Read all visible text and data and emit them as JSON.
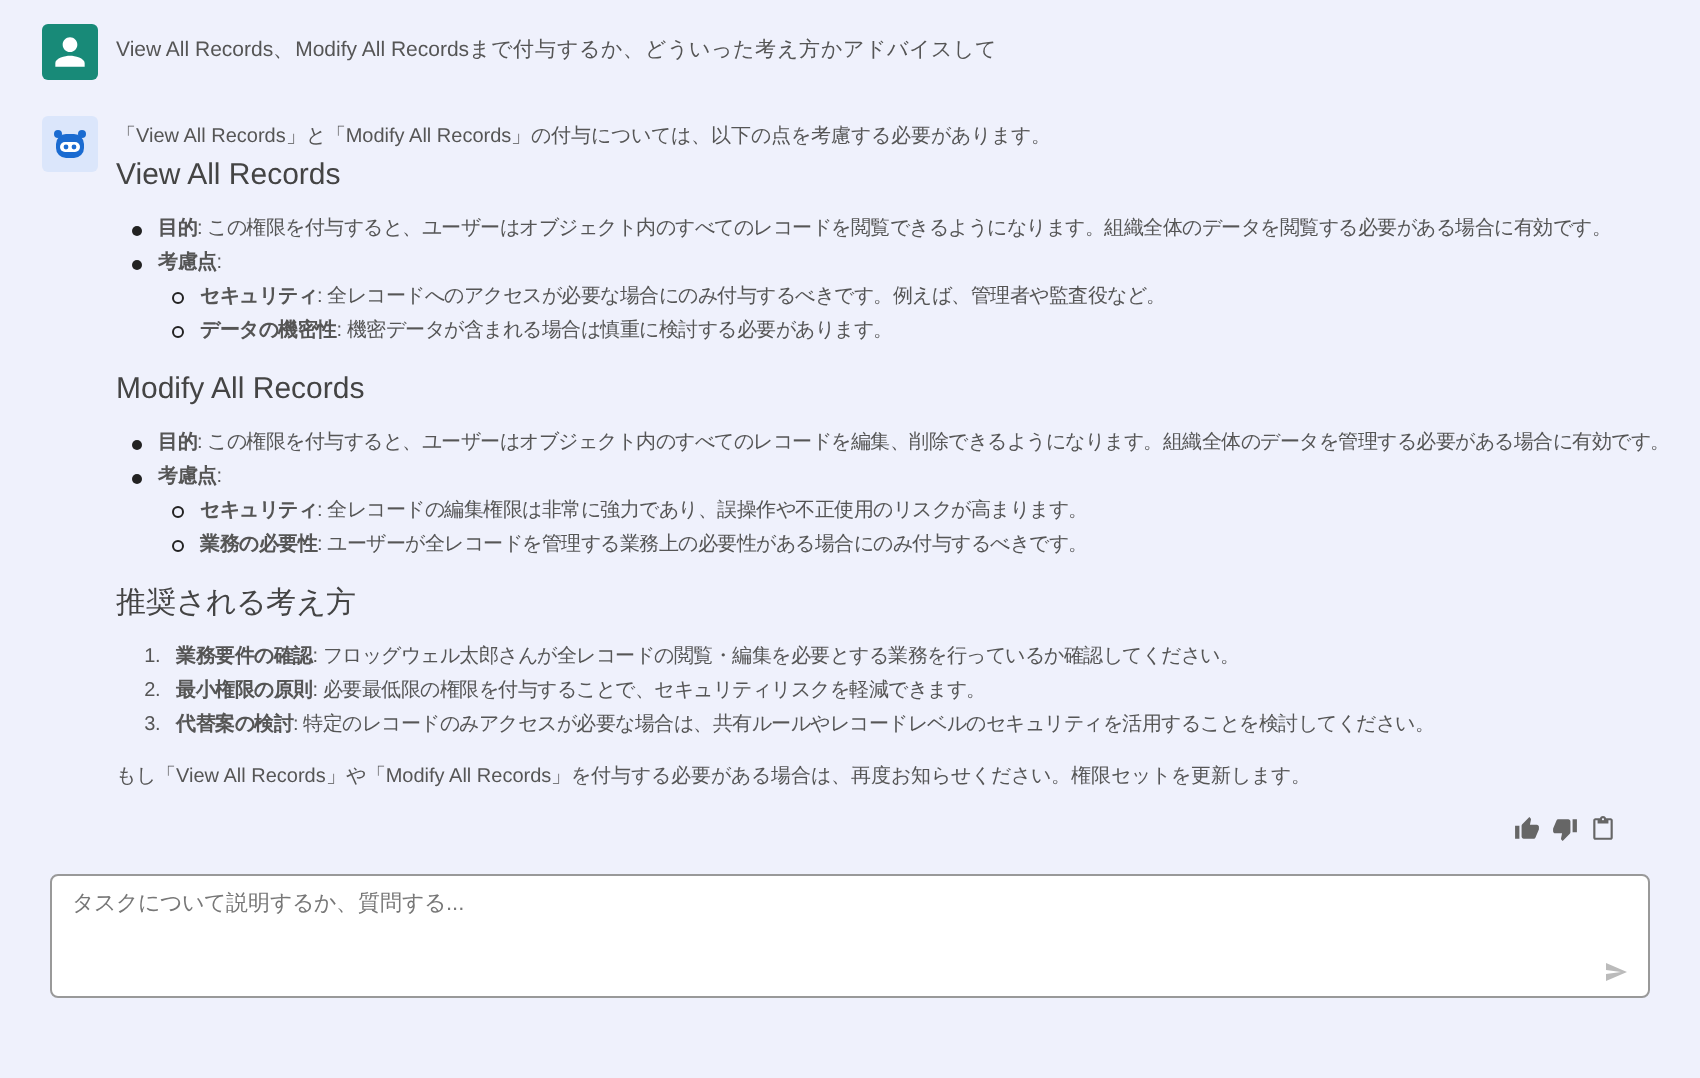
{
  "user_message": {
    "text": "View All Records、Modify All Recordsまで付与するか、どういった考え方かアドバイスして"
  },
  "assistant_message": {
    "intro": "「View All Records」と「Modify All Records」の付与については、以下の点を考慮する必要があります。",
    "sections": [
      {
        "heading": "View All Records",
        "kind": "bullet",
        "items": [
          {
            "text": "**目的**: この権限を付与すると、ユーザーはオブジェクト内のすべてのレコードを閲覧できるようになります。組織全体のデータを閲覧する必要がある場合に有効です。"
          },
          {
            "text": "**考慮点**:",
            "children": [
              {
                "text": "**セキュリティ**: 全レコードへのアクセスが必要な場合にのみ付与するべきです。例えば、管理者や監査役など。"
              },
              {
                "text": "**データの機密性**: 機密データが含まれる場合は慎重に検討する必要があります。"
              }
            ]
          }
        ]
      },
      {
        "heading": "Modify All Records",
        "kind": "bullet",
        "items": [
          {
            "text": "**目的**: この権限を付与すると、ユーザーはオブジェクト内のすべてのレコードを編集、削除できるようになります。組織全体のデータを管理する必要がある場合に有効です。"
          },
          {
            "text": "**考慮点**:",
            "children": [
              {
                "text": "**セキュリティ**: 全レコードの編集権限は非常に強力であり、誤操作や不正使用のリスクが高まります。"
              },
              {
                "text": "**業務の必要性**: ユーザーが全レコードを管理する業務上の必要性がある場合にのみ付与するべきです。"
              }
            ]
          }
        ]
      },
      {
        "heading": "推奨される考え方",
        "kind": "numbered",
        "items": [
          {
            "marker": "1.",
            "text": "**業務要件の確認**: フロッグウェル太郎さんが全レコードの閲覧・編集を必要とする業務を行っているか確認してください。"
          },
          {
            "marker": "2.",
            "text": "**最小権限の原則**: 必要最低限の権限を付与することで、セキュリティリスクを軽減できます。"
          },
          {
            "marker": "3.",
            "text": "**代替案の検討**: 特定のレコードのみアクセスが必要な場合は、共有ルールやレコードレベルのセキュリティを活用することを検討してください。"
          }
        ]
      }
    ],
    "closing": "もし「View All Records」や「Modify All Records」を付与する必要がある場合は、再度お知らせください。権限セットを更新します。"
  },
  "composer": {
    "placeholder": "タスクについて説明するか、質問する..."
  }
}
